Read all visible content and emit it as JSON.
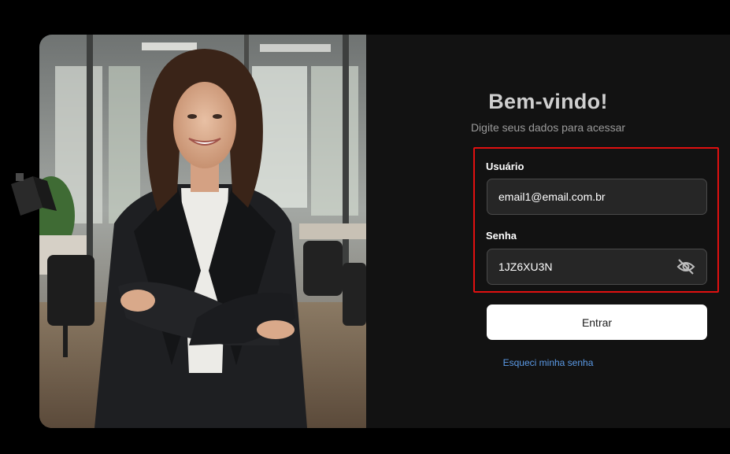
{
  "login": {
    "title": "Bem-vindo!",
    "subtitle": "Digite seus dados para acessar",
    "username_label": "Usuário",
    "username_value": "email1@email.com.br",
    "password_label": "Senha",
    "password_value": "1JZ6XU3N",
    "submit_label": "Entrar",
    "forgot_label": "Esqueci minha senha"
  },
  "icons": {
    "password_toggle": "eye-off-icon"
  },
  "colors": {
    "background": "#000000",
    "panel": "#121212",
    "input_bg": "#262626",
    "highlight": "#e01010",
    "link": "#5b9ae6",
    "button": "#ffffff"
  }
}
